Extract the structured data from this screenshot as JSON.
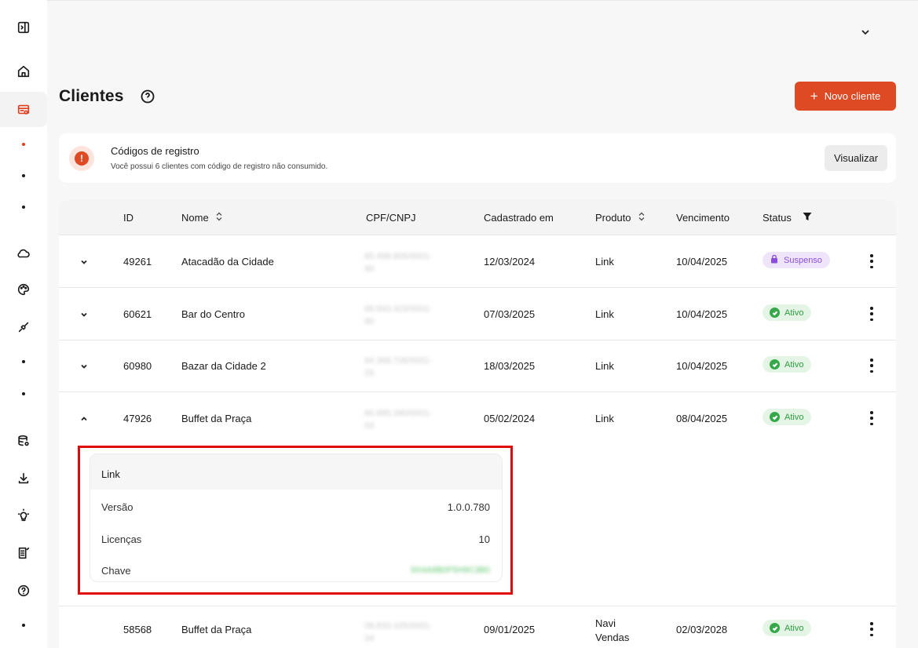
{
  "sidebar": {
    "items": [
      {
        "icon": "sidebar-toggle-icon"
      },
      {
        "icon": "home-icon"
      },
      {
        "icon": "clients-icon",
        "active": true
      },
      {
        "icon": "cloud-icon"
      },
      {
        "icon": "palette-icon"
      },
      {
        "icon": "plug-icon"
      },
      {
        "icon": "database-settings-icon"
      },
      {
        "icon": "download-icon"
      },
      {
        "icon": "lightbulb-icon"
      },
      {
        "icon": "news-icon"
      },
      {
        "icon": "help-icon"
      }
    ]
  },
  "header": {
    "title": "Clientes",
    "new_button_label": "Novo cliente"
  },
  "alert": {
    "title": "Códigos de registro",
    "text": "Você possui 6 clientes com código de registro não consumido.",
    "button_label": "Visualizar"
  },
  "table": {
    "columns": {
      "id": "ID",
      "name": "Nome",
      "doc": "CPF/CNPJ",
      "created": "Cadastrado em",
      "product": "Produto",
      "due": "Vencimento",
      "status": "Status"
    },
    "rows": [
      {
        "id": "49261",
        "name": "Atacadão da Cidade",
        "doc": "65.498.805/0001-",
        "doc2": "99",
        "created": "12/03/2024",
        "product": "Link",
        "due": "10/04/2025",
        "status": "Suspenso"
      },
      {
        "id": "60621",
        "name": "Bar do Centro",
        "doc": "68.843.323/0001-",
        "doc2": "80",
        "created": "07/03/2025",
        "product": "Link",
        "due": "10/04/2025",
        "status": "Ativo"
      },
      {
        "id": "60980",
        "name": "Bazar da Cidade 2",
        "doc": "94.368.726/0001-",
        "doc2": "25",
        "created": "18/03/2025",
        "product": "Link",
        "due": "10/04/2025",
        "status": "Ativo"
      },
      {
        "id": "47926",
        "name": "Buffet da Praça",
        "doc": "66.685.390/0001-",
        "doc2": "03",
        "created": "05/02/2024",
        "product": "Link",
        "due": "08/04/2025",
        "status": "Ativo"
      },
      {
        "id": "58568",
        "name": "Buffet da Praça",
        "doc": "08.833.105/0001-",
        "doc2": "34",
        "created": "09/01/2025",
        "product": "Navi",
        "product2": "Vendas",
        "due": "02/03/2028",
        "status": "Ativo"
      }
    ],
    "expanded": {
      "header": "Link",
      "version_label": "Versão",
      "version_value": "1.0.0.780",
      "licenses_label": "Licenças",
      "licenses_value": "10",
      "key_label": "Chave",
      "key_value": "9X4A8B0F5H9C3B0"
    }
  },
  "colors": {
    "accent": "#dd4a23",
    "active_badge": "#36a84a",
    "suspended_badge": "#8a4fd8",
    "highlight": "#e00a0a"
  }
}
